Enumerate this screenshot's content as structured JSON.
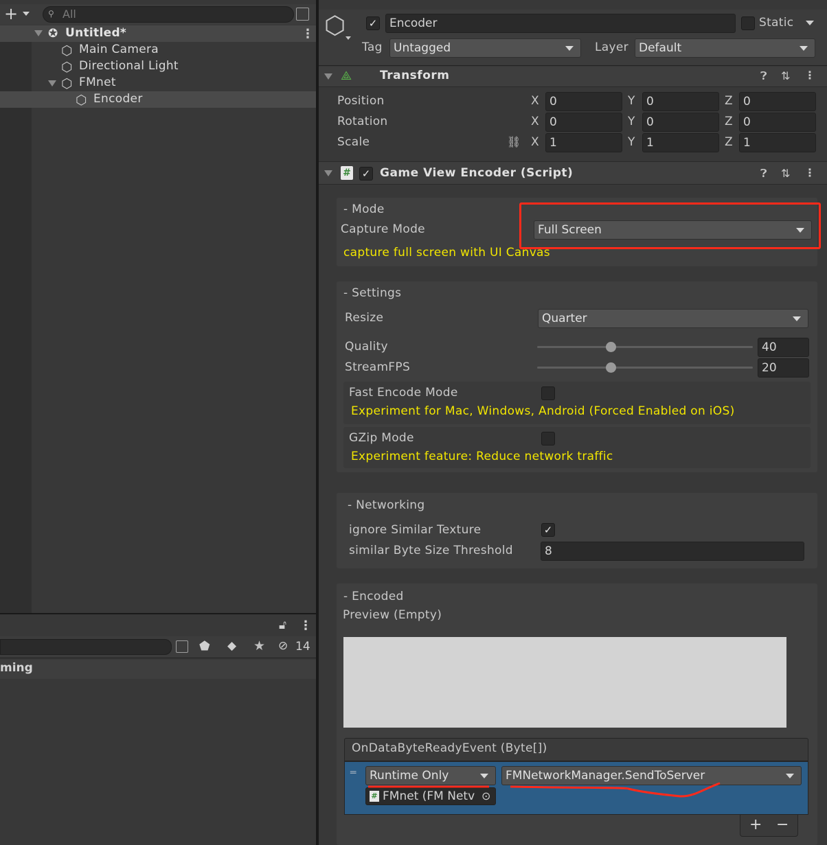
{
  "hierarchy": {
    "add_symbol": "+",
    "search_placeholder": "All",
    "scene_name": "Untitled*",
    "items": [
      "Main Camera",
      "Directional Light",
      "FMnet",
      "Encoder"
    ]
  },
  "project": {
    "hidden_count": "14",
    "folder_partial": "ming"
  },
  "inspector": {
    "object_name": "Encoder",
    "static_label": "Static",
    "tag_label": "Tag",
    "tag_value": "Untagged",
    "layer_label": "Layer",
    "layer_value": "Default",
    "transform": {
      "title": "Transform",
      "position_label": "Position",
      "rotation_label": "Rotation",
      "scale_label": "Scale",
      "axis_x": "X",
      "axis_y": "Y",
      "axis_z": "Z",
      "position": [
        "0",
        "0",
        "0"
      ],
      "rotation": [
        "0",
        "0",
        "0"
      ],
      "scale": [
        "1",
        "1",
        "1"
      ]
    },
    "script": {
      "title": "Game View Encoder (Script)",
      "mode_header": "- Mode",
      "capture_mode_label": "Capture Mode",
      "capture_mode_value": "Full Screen",
      "capture_note": "capture full screen with UI Canvas",
      "settings_header": "- Settings",
      "resize_label": "Resize",
      "resize_value": "Quarter",
      "quality_label": "Quality",
      "quality_value": "40",
      "quality_fraction": 0.34,
      "streamfps_label": "StreamFPS",
      "streamfps_value": "20",
      "streamfps_fraction": 0.34,
      "fast_encode_label": "Fast Encode Mode",
      "fast_encode_note": "Experiment for Mac, Windows, Android (Forced Enabled on iOS)",
      "gzip_label": "GZip Mode",
      "gzip_note": "Experiment feature: Reduce network traffic",
      "networking_header": "- Networking",
      "ignore_similar_label": "ignore Similar Texture",
      "threshold_label": "similar Byte Size Threshold",
      "threshold_value": "8",
      "encoded_header": "- Encoded",
      "preview_label": "Preview (Empty)",
      "event_header": "OnDataByteReadyEvent (Byte[])",
      "runtime_value": "Runtime Only",
      "function_value": "FMNetworkManager.SendToServer",
      "object_ref": "FMnet (FM Netv",
      "plus": "+",
      "minus": "−"
    }
  },
  "colors": {
    "highlight_box": "#ff2a1a",
    "note_text": "#f2e600",
    "event_row_bg": "#2c5d87"
  }
}
